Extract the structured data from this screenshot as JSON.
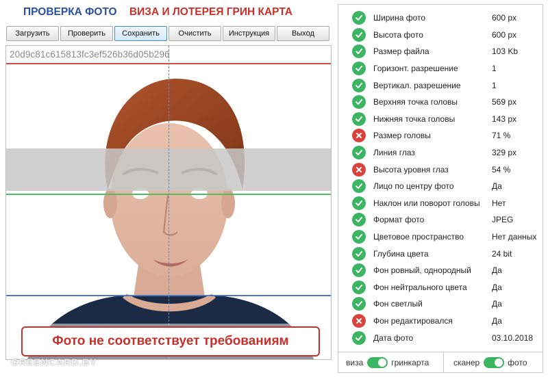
{
  "header": {
    "title_left": "ПРОВЕРКА ФОТО",
    "title_right": "ВИЗА И ЛОТЕРЕЯ ГРИН КАРТА"
  },
  "toolbar": {
    "buttons": [
      {
        "label": "Загрузить"
      },
      {
        "label": "Проверить"
      },
      {
        "label": "Сохранить"
      },
      {
        "label": "Очистить"
      },
      {
        "label": "Инструкция"
      },
      {
        "label": "Выход"
      }
    ],
    "active": "Сохранить"
  },
  "photo": {
    "hash": "20d9c81c615813fc3ef526b36d05b296",
    "verdict": "Фото не соответствует требованиям",
    "watermark": "GREENCARD.BY"
  },
  "checks": [
    {
      "label": "Ширина фото",
      "value": "600 px",
      "status": "ok"
    },
    {
      "label": "Высота фото",
      "value": "600 px",
      "status": "ok"
    },
    {
      "label": "Размер файла",
      "value": "103 Kb",
      "status": "ok"
    },
    {
      "label": "Горизонт. разрешение",
      "value": "1",
      "status": "ok"
    },
    {
      "label": "Вертикал. разрешение",
      "value": "1",
      "status": "ok"
    },
    {
      "label": "Верхняя точка головы",
      "value": "569 px",
      "status": "ok"
    },
    {
      "label": "Нижняя точка головы",
      "value": "143 px",
      "status": "ok"
    },
    {
      "label": "Размер головы",
      "value": "71 %",
      "status": "bad"
    },
    {
      "label": "Линия глаз",
      "value": "329 px",
      "status": "ok"
    },
    {
      "label": "Высота уровня глаз",
      "value": "54 %",
      "status": "bad"
    },
    {
      "label": "Лицо по центру фото",
      "value": "Да",
      "status": "ok"
    },
    {
      "label": "Наклон или поворот головы",
      "value": "Нет",
      "status": "ok"
    },
    {
      "label": "Формат фото",
      "value": "JPEG",
      "status": "ok"
    },
    {
      "label": "Цветовое пространство",
      "value": "Нет данных",
      "status": "ok"
    },
    {
      "label": "Глубина цвета",
      "value": "24 bit",
      "status": "ok"
    },
    {
      "label": "Фон ровный, однородный",
      "value": "Да",
      "status": "ok"
    },
    {
      "label": "Фон нейтрального цвета",
      "value": "Да",
      "status": "ok"
    },
    {
      "label": "Фон светлый",
      "value": "Да",
      "status": "ok"
    },
    {
      "label": "Фон редактировался",
      "value": "Да",
      "status": "bad"
    },
    {
      "label": "Дата фото",
      "value": "03.10.2018",
      "status": "ok"
    }
  ],
  "footer": {
    "mode_left": "виза",
    "mode_right": "гринкарта",
    "source_left": "сканер",
    "source_right": "фото"
  },
  "colors": {
    "ok": "#3cb563",
    "bad": "#d9433c",
    "title_blue": "#2b4fa0",
    "title_red": "#c8302b"
  },
  "icons": {
    "ok": "check-circle-icon",
    "bad": "cross-circle-icon"
  }
}
